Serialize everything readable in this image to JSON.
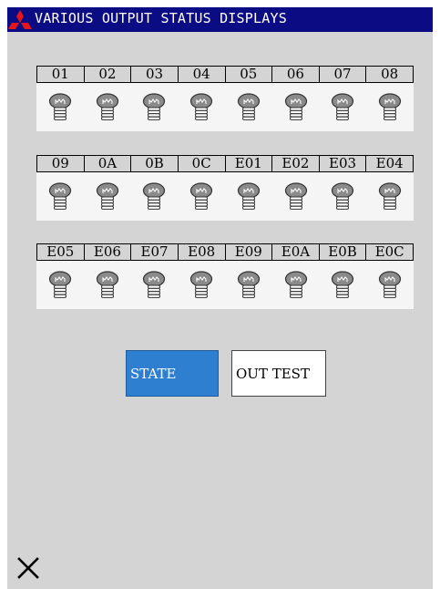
{
  "window": {
    "title": "VARIOUS OUTPUT STATUS DISPLAYS",
    "logo_icon": "mitsubishi-logo-icon",
    "title_bar_color": "#0b0b84",
    "background_color": "#d4d4d4"
  },
  "groups": [
    {
      "labels": [
        "01",
        "02",
        "03",
        "04",
        "05",
        "06",
        "07",
        "08"
      ]
    },
    {
      "labels": [
        "09",
        "0A",
        "0B",
        "0C",
        "E01",
        "E02",
        "E03",
        "E04"
      ]
    },
    {
      "labels": [
        "E05",
        "E06",
        "E07",
        "E08",
        "E09",
        "E0A",
        "E0B",
        "E0C"
      ]
    }
  ],
  "indicator": {
    "icon": "light-bulb-icon",
    "state": "off",
    "color": "#8a8a8a"
  },
  "buttons": {
    "state_label": "STATE",
    "state_color": "#2f7fd1",
    "out_test_label": "OUT TEST"
  },
  "close_button": {
    "icon": "close-icon"
  }
}
